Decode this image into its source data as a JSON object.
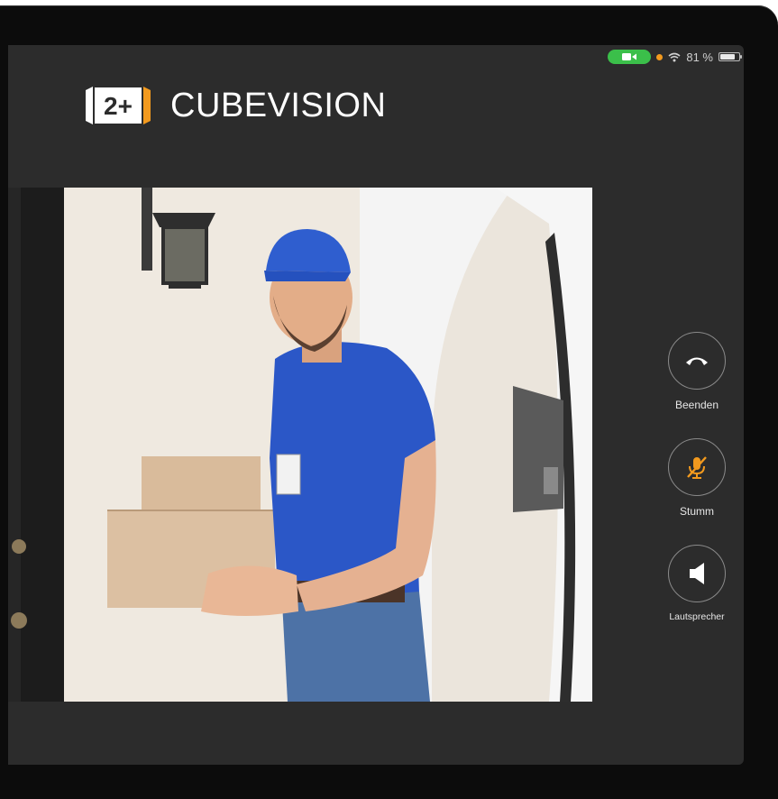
{
  "status_bar": {
    "battery_percent_text": "81 %",
    "battery_level": 0.81,
    "camera_active_color": "#3bbf4a",
    "indicator_dot_color": "#f39a1e",
    "icons": [
      "video-camera-icon",
      "wifi-icon",
      "battery-icon"
    ]
  },
  "brand": {
    "logo_mark_text": "2+",
    "name": "CUBEVISION",
    "accent_color": "#f39a1e"
  },
  "video_feed": {
    "content": "live doorbell camera view"
  },
  "controls": {
    "end_call_label": "Beenden",
    "mute_label": "Stumm",
    "speaker_label": "Lautsprecher",
    "mute_icon_color": "#f39a1e",
    "icons": [
      "hang-up-icon",
      "microphone-muted-icon",
      "speaker-icon"
    ]
  }
}
